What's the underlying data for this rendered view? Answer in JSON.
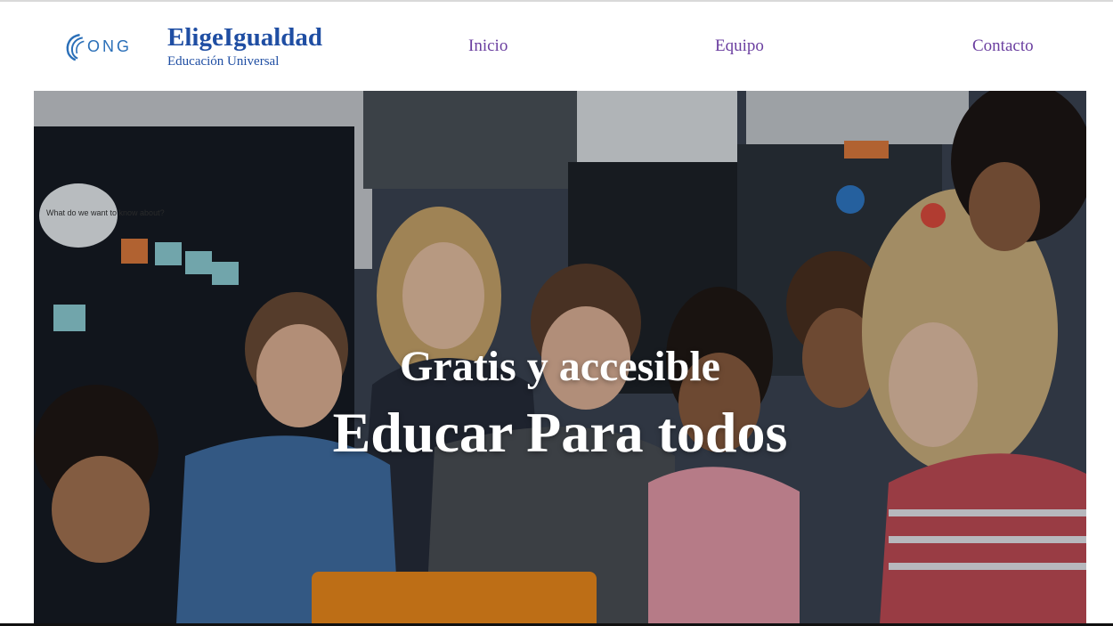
{
  "header": {
    "logo_text": "ONG",
    "brand_title": "EligeIgualdad",
    "brand_subtitle": "Educación Universal"
  },
  "nav": {
    "items": [
      {
        "label": "Inicio"
      },
      {
        "label": "Equipo"
      },
      {
        "label": "Contacto"
      }
    ]
  },
  "hero": {
    "subtitle": "Gratis y accesible",
    "title": "Educar Para todos",
    "board_note": "What do we want to know about?"
  },
  "colors": {
    "brand": "#1f4ea3",
    "nav_link": "#6b3fa0",
    "hero_text": "#ffffff"
  }
}
